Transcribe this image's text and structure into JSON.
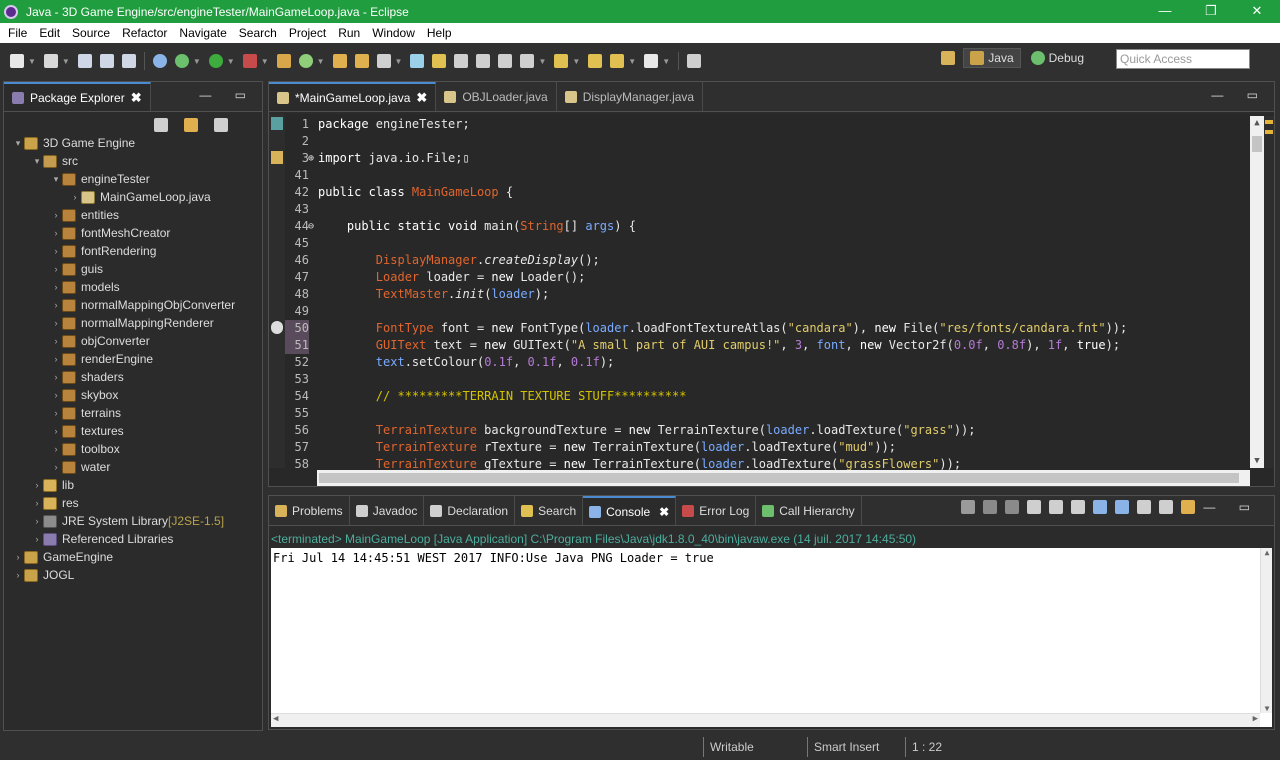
{
  "window": {
    "title": "Java - 3D Game Engine/src/engineTester/MainGameLoop.java - Eclipse",
    "minimize": "—",
    "restore": "❐",
    "close": "✕"
  },
  "menu": [
    "File",
    "Edit",
    "Source",
    "Refactor",
    "Navigate",
    "Search",
    "Project",
    "Run",
    "Window",
    "Help"
  ],
  "perspectives": {
    "java": "Java",
    "debug": "Debug"
  },
  "quick_access_placeholder": "Quick Access",
  "package_explorer": {
    "tab_label": "Package Explorer",
    "tree": [
      {
        "label": "3D Game Engine",
        "level": 0,
        "icon": "project",
        "twist": "▾"
      },
      {
        "label": "src",
        "level": 1,
        "icon": "src",
        "twist": "▾"
      },
      {
        "label": "engineTester",
        "level": 2,
        "icon": "package",
        "twist": "▾"
      },
      {
        "label": "MainGameLoop.java",
        "level": 3,
        "icon": "java",
        "twist": "›"
      },
      {
        "label": "entities",
        "level": 2,
        "icon": "package",
        "twist": "›"
      },
      {
        "label": "fontMeshCreator",
        "level": 2,
        "icon": "package",
        "twist": "›"
      },
      {
        "label": "fontRendering",
        "level": 2,
        "icon": "package",
        "twist": "›"
      },
      {
        "label": "guis",
        "level": 2,
        "icon": "package",
        "twist": "›"
      },
      {
        "label": "models",
        "level": 2,
        "icon": "package",
        "twist": "›"
      },
      {
        "label": "normalMappingObjConverter",
        "level": 2,
        "icon": "package",
        "twist": "›"
      },
      {
        "label": "normalMappingRenderer",
        "level": 2,
        "icon": "package",
        "twist": "›"
      },
      {
        "label": "objConverter",
        "level": 2,
        "icon": "package",
        "twist": "›"
      },
      {
        "label": "renderEngine",
        "level": 2,
        "icon": "package",
        "twist": "›"
      },
      {
        "label": "shaders",
        "level": 2,
        "icon": "package",
        "twist": "›"
      },
      {
        "label": "skybox",
        "level": 2,
        "icon": "package",
        "twist": "›"
      },
      {
        "label": "terrains",
        "level": 2,
        "icon": "package",
        "twist": "›"
      },
      {
        "label": "textures",
        "level": 2,
        "icon": "package",
        "twist": "›"
      },
      {
        "label": "toolbox",
        "level": 2,
        "icon": "package",
        "twist": "›"
      },
      {
        "label": "water",
        "level": 2,
        "icon": "package",
        "twist": "›"
      },
      {
        "label": "lib",
        "level": 1,
        "icon": "folder",
        "twist": "›"
      },
      {
        "label": "res",
        "level": 1,
        "icon": "folder",
        "twist": "›"
      },
      {
        "label": "JRE System Library",
        "suffix": " [J2SE-1.5]",
        "level": 1,
        "icon": "jre",
        "twist": "›"
      },
      {
        "label": "Referenced Libraries",
        "level": 1,
        "icon": "lib",
        "twist": "›"
      },
      {
        "label": "GameEngine",
        "level": 0,
        "icon": "project",
        "twist": "›"
      },
      {
        "label": "JOGL",
        "level": 0,
        "icon": "project",
        "twist": "›"
      }
    ]
  },
  "editor": {
    "tabs": [
      {
        "label": "*MainGameLoop.java",
        "active": true,
        "close": "✖"
      },
      {
        "label": "OBJLoader.java",
        "active": false
      },
      {
        "label": "DisplayManager.java",
        "active": false
      }
    ],
    "line_numbers": [
      "1",
      "2",
      "3",
      "41",
      "42",
      "43",
      "44",
      "45",
      "46",
      "47",
      "48",
      "49",
      "50",
      "51",
      "52",
      "53",
      "54",
      "55",
      "56",
      "57",
      "58"
    ],
    "fold_markers": {
      "2": "⊕",
      "6": "⊖"
    },
    "highlighted_lines": [
      13,
      14
    ],
    "code": [
      [
        {
          "t": "package ",
          "c": "kw"
        },
        {
          "t": "engineTester;",
          "c": "vr"
        }
      ],
      [],
      [
        {
          "t": "import ",
          "c": "kw"
        },
        {
          "t": "java.io.File;",
          "c": "vr"
        },
        {
          "t": "▯",
          "c": "vr"
        }
      ],
      [],
      [
        {
          "t": "public class ",
          "c": "kw"
        },
        {
          "t": "MainGameLoop",
          "c": "ty"
        },
        {
          "t": " {",
          "c": "vr"
        }
      ],
      [],
      [
        {
          "t": "    public static void ",
          "c": "kw"
        },
        {
          "t": "main(",
          "c": "mt"
        },
        {
          "t": "String",
          "c": "ty"
        },
        {
          "t": "[] ",
          "c": "vr"
        },
        {
          "t": "args",
          "c": "pr"
        },
        {
          "t": ") {",
          "c": "vr"
        }
      ],
      [],
      [
        {
          "t": "        ",
          "c": "vr"
        },
        {
          "t": "DisplayManager",
          "c": "ty"
        },
        {
          "t": ".",
          "c": "vr"
        },
        {
          "t": "createDisplay",
          "c": "mt it"
        },
        {
          "t": "();",
          "c": "vr"
        }
      ],
      [
        {
          "t": "        ",
          "c": "vr"
        },
        {
          "t": "Loader",
          "c": "ty"
        },
        {
          "t": " loader = ",
          "c": "vr"
        },
        {
          "t": "new ",
          "c": "kw"
        },
        {
          "t": "Loader();",
          "c": "vr"
        }
      ],
      [
        {
          "t": "        ",
          "c": "vr"
        },
        {
          "t": "TextMaster",
          "c": "ty"
        },
        {
          "t": ".",
          "c": "vr"
        },
        {
          "t": "init",
          "c": "mt it"
        },
        {
          "t": "(",
          "c": "vr"
        },
        {
          "t": "loader",
          "c": "pr"
        },
        {
          "t": ");",
          "c": "vr"
        }
      ],
      [],
      [
        {
          "t": "        ",
          "c": "vr"
        },
        {
          "t": "FontType",
          "c": "ty"
        },
        {
          "t": " font = ",
          "c": "vr"
        },
        {
          "t": "new ",
          "c": "kw"
        },
        {
          "t": "FontType(",
          "c": "vr"
        },
        {
          "t": "loader",
          "c": "pr"
        },
        {
          "t": ".loadFontTextureAtlas(",
          "c": "vr"
        },
        {
          "t": "\"candara\"",
          "c": "st"
        },
        {
          "t": "), ",
          "c": "vr"
        },
        {
          "t": "new ",
          "c": "kw"
        },
        {
          "t": "File(",
          "c": "vr"
        },
        {
          "t": "\"res/fonts/candara.fnt\"",
          "c": "st"
        },
        {
          "t": "));",
          "c": "vr"
        }
      ],
      [
        {
          "t": "        ",
          "c": "vr"
        },
        {
          "t": "GUIText",
          "c": "ty"
        },
        {
          "t": " text = ",
          "c": "vr"
        },
        {
          "t": "new ",
          "c": "kw"
        },
        {
          "t": "GUIText(",
          "c": "vr"
        },
        {
          "t": "\"A small part of AUI campus!\"",
          "c": "st"
        },
        {
          "t": ", ",
          "c": "vr"
        },
        {
          "t": "3",
          "c": "nm"
        },
        {
          "t": ", ",
          "c": "vr"
        },
        {
          "t": "font",
          "c": "pr"
        },
        {
          "t": ", ",
          "c": "vr"
        },
        {
          "t": "new ",
          "c": "kw"
        },
        {
          "t": "Vector2f(",
          "c": "vr"
        },
        {
          "t": "0.0f",
          "c": "nm"
        },
        {
          "t": ", ",
          "c": "vr"
        },
        {
          "t": "0.8f",
          "c": "nm"
        },
        {
          "t": "), ",
          "c": "vr"
        },
        {
          "t": "1f",
          "c": "nm"
        },
        {
          "t": ", ",
          "c": "vr"
        },
        {
          "t": "true",
          "c": "kw"
        },
        {
          "t": ");",
          "c": "vr"
        }
      ],
      [
        {
          "t": "        ",
          "c": "vr"
        },
        {
          "t": "text",
          "c": "pr"
        },
        {
          "t": ".setColour(",
          "c": "vr"
        },
        {
          "t": "0.1f",
          "c": "nm"
        },
        {
          "t": ", ",
          "c": "vr"
        },
        {
          "t": "0.1f",
          "c": "nm"
        },
        {
          "t": ", ",
          "c": "vr"
        },
        {
          "t": "0.1f",
          "c": "nm"
        },
        {
          "t": ");",
          "c": "vr"
        }
      ],
      [],
      [
        {
          "t": "        ",
          "c": "vr"
        },
        {
          "t": "// *********TERRAIN TEXTURE STUFF**********",
          "c": "cm"
        }
      ],
      [],
      [
        {
          "t": "        ",
          "c": "vr"
        },
        {
          "t": "TerrainTexture",
          "c": "ty"
        },
        {
          "t": " backgroundTexture = ",
          "c": "vr"
        },
        {
          "t": "new ",
          "c": "kw"
        },
        {
          "t": "TerrainTexture(",
          "c": "vr"
        },
        {
          "t": "loader",
          "c": "pr"
        },
        {
          "t": ".loadTexture(",
          "c": "vr"
        },
        {
          "t": "\"grass\"",
          "c": "st"
        },
        {
          "t": "));",
          "c": "vr"
        }
      ],
      [
        {
          "t": "        ",
          "c": "vr"
        },
        {
          "t": "TerrainTexture",
          "c": "ty"
        },
        {
          "t": " rTexture = ",
          "c": "vr"
        },
        {
          "t": "new ",
          "c": "kw"
        },
        {
          "t": "TerrainTexture(",
          "c": "vr"
        },
        {
          "t": "loader",
          "c": "pr"
        },
        {
          "t": ".loadTexture(",
          "c": "vr"
        },
        {
          "t": "\"mud\"",
          "c": "st"
        },
        {
          "t": "));",
          "c": "vr"
        }
      ],
      [
        {
          "t": "        ",
          "c": "vr"
        },
        {
          "t": "TerrainTexture",
          "c": "ty"
        },
        {
          "t": " gTexture = ",
          "c": "vr"
        },
        {
          "t": "new ",
          "c": "kw"
        },
        {
          "t": "TerrainTexture(",
          "c": "vr"
        },
        {
          "t": "loader",
          "c": "pr"
        },
        {
          "t": ".loadTexture(",
          "c": "vr"
        },
        {
          "t": "\"grassFlowers\"",
          "c": "st"
        },
        {
          "t": "));",
          "c": "vr"
        }
      ]
    ]
  },
  "bottom_panel": {
    "tabs": [
      {
        "label": "Problems",
        "icon": "problems-icon",
        "active": false
      },
      {
        "label": "Javadoc",
        "icon": "javadoc-icon",
        "active": false
      },
      {
        "label": "Declaration",
        "icon": "declaration-icon",
        "active": false
      },
      {
        "label": "Search",
        "icon": "search-icon",
        "active": false
      },
      {
        "label": "Console",
        "icon": "console-icon",
        "active": true,
        "close": "✖"
      },
      {
        "label": "Error Log",
        "icon": "error-log-icon",
        "active": false
      },
      {
        "label": "Call Hierarchy",
        "icon": "call-hierarchy-icon",
        "active": false
      }
    ],
    "console_header": "<terminated> MainGameLoop [Java Application] C:\\Program Files\\Java\\jdk1.8.0_40\\bin\\javaw.exe (14 juil. 2017 14:45:50)",
    "console_output": "Fri Jul 14 14:45:51 WEST 2017 INFO:Use Java PNG Loader = true"
  },
  "status": {
    "writable": "Writable",
    "insert_mode": "Smart Insert",
    "position": "1 : 22"
  },
  "colors": {
    "title_bar": "#1f9d3f",
    "keyword": "#ffffff",
    "type": "#e0652e",
    "string": "#e2cc6a",
    "number": "#b57bd6",
    "param": "#79abff",
    "comment": "#d4c400",
    "console_info": "#4cae9e"
  }
}
